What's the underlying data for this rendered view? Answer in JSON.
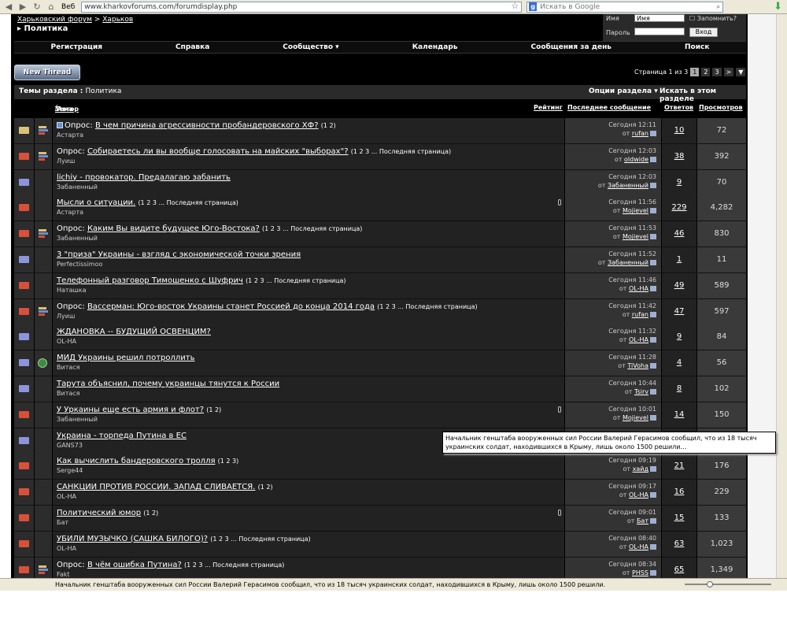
{
  "browser": {
    "web_label": "Веб",
    "url": "www.kharkovforums.com/forumdisplay.php",
    "search_placeholder": "Искать в Google"
  },
  "breadcrumb": {
    "root": "Харьковский форум",
    "parent": "Харьков",
    "current": "Политика"
  },
  "login": {
    "user_label": "Имя",
    "user_value": "Имя",
    "remember": "Запомнить?",
    "pass_label": "Пароль",
    "submit": "Вход"
  },
  "nav": [
    "Регистрация",
    "Справка",
    "Сообщество ▾",
    "Календарь",
    "Сообщения за день",
    "Поиск"
  ],
  "new_thread": "New Thread",
  "pager": {
    "label": "Страница 1 из 3",
    "pages": [
      "1",
      "2",
      "3",
      ">"
    ]
  },
  "table": {
    "title": "Темы раздела",
    "section": "Политика",
    "options": "Опции раздела ▾",
    "search": "Искать в этом разделе",
    "col_topic": "Тема",
    "col_author": "Автор",
    "col_rating": "Рейтинг",
    "col_last": "Последнее сообщение",
    "col_replies": "Ответов",
    "col_views": "Просмотров"
  },
  "threads": [
    {
      "prefix": "Опрос:",
      "title": "В чем причина агрессивности пробандеровского ХФ?",
      "pages": "(1 2)",
      "author": "Астарта",
      "time": "Сегодня 12:11",
      "by": "rufan",
      "replies": "10",
      "views": "72"
    },
    {
      "prefix": "Опрос:",
      "title": "Собираетесь ли вы вообще голосовать на майских \"выборах\"?",
      "pages": "(1 2 3 ... Последняя страница)",
      "author": "Луиш",
      "time": "Сегодня 12:03",
      "by": "oldwide",
      "replies": "38",
      "views": "392"
    },
    {
      "prefix": "",
      "title": "lichiy - провокатор. Предалагаю забанить",
      "pages": "",
      "author": "Забаненный",
      "time": "Сегодня 12:03",
      "by": "Забаненный",
      "replies": "9",
      "views": "70"
    },
    {
      "prefix": "",
      "title": "Мысли о ситуации.",
      "pages": "(1 2 3 ... Последняя страница)",
      "author": "Астарта",
      "time": "Сегодня 11:56",
      "by": "Mojievel",
      "replies": "229",
      "views": "4,282"
    },
    {
      "prefix": "Опрос:",
      "title": "Каким Вы видите будущее Юго-Востока?",
      "pages": "(1 2 3 ... Последняя страница)",
      "author": "Забаненный",
      "time": "Сегодня 11:53",
      "by": "Mojievel",
      "replies": "46",
      "views": "830"
    },
    {
      "prefix": "",
      "title": "3 \"приза\" Украины - взгляд с экономической точки зрения",
      "pages": "",
      "author": "Perfectissimoo",
      "time": "Сегодня 11:52",
      "by": "Забаненный",
      "replies": "1",
      "views": "11"
    },
    {
      "prefix": "",
      "title": "Телефонный разговор Тимошенко с Шуфрич",
      "pages": "(1 2 3 ... Последняя страница)",
      "author": "Наташка",
      "time": "Сегодня 11:46",
      "by": "OL-HA",
      "replies": "49",
      "views": "589"
    },
    {
      "prefix": "Опрос:",
      "title": "Вассерман: Юго-восток Украины станет Россией до конца 2014 года",
      "pages": "(1 2 3 ... Последняя страница)",
      "author": "Луиш",
      "time": "Сегодня 11:42",
      "by": "rufan",
      "replies": "47",
      "views": "597"
    },
    {
      "prefix": "",
      "title": "ЖДАНОВКА -- БУДУЩИЙ ОСВЕНЦИМ?",
      "pages": "",
      "author": "OL-HA",
      "time": "Сегодня 11:32",
      "by": "OL-HA",
      "replies": "9",
      "views": "84"
    },
    {
      "prefix": "",
      "title": "МИД Украины решил потроллить",
      "pages": "",
      "author": "Витася",
      "time": "Сегодня 11:28",
      "by": "TiVoha",
      "replies": "4",
      "views": "56"
    },
    {
      "prefix": "",
      "title": "Тарута объяснил, почему украинцы тянутся к России",
      "pages": "",
      "author": "Витася",
      "time": "Сегодня 10:44",
      "by": "Tsirv",
      "replies": "8",
      "views": "102"
    },
    {
      "prefix": "",
      "title": "У Уркаины еще есть армия и флот?",
      "pages": "(1 2)",
      "author": "Забаненный",
      "time": "Сегодня 10:01",
      "by": "Mojievel",
      "replies": "14",
      "views": "150"
    },
    {
      "prefix": "",
      "title": "Украина - торпеда Путина в ЕС",
      "pages": "",
      "author": "GANS73",
      "time": "",
      "by": "",
      "replies": "",
      "views": ""
    },
    {
      "prefix": "",
      "title": "Как вычислить бандеровского тролля",
      "pages": "(1 2 3)",
      "author": "Serge44",
      "time": "Сегодня 09:19",
      "by": "хайд",
      "replies": "21",
      "views": "176"
    },
    {
      "prefix": "",
      "title": "САНКЦИИ ПРОТИВ РОССИИ. ЗАПАД СЛИВАЕТСЯ.",
      "pages": "(1 2)",
      "author": "OL-HA",
      "time": "Сегодня 09:17",
      "by": "OL-HA",
      "replies": "16",
      "views": "229"
    },
    {
      "prefix": "",
      "title": "Политический юмор",
      "pages": "(1 2)",
      "author": "Бат",
      "time": "Сегодня 09:01",
      "by": "Бат",
      "replies": "15",
      "views": "133"
    },
    {
      "prefix": "",
      "title": "УБИЛИ МУЗЫЧКО (САШКА БИЛОГО)?",
      "pages": "(1 2 3 ... Последняя страница)",
      "author": "OL-HA",
      "time": "Сегодня 08:40",
      "by": "OL-HA",
      "replies": "63",
      "views": "1,023"
    },
    {
      "prefix": "Опрос:",
      "title": "В чём ошибка Путина?",
      "pages": "(1 2 3 ... Последняя страница)",
      "author": "Fakt",
      "time": "Сегодня 08:34",
      "by": "PHSS",
      "replies": "65",
      "views": "1,349"
    }
  ],
  "by_prefix": "от",
  "tooltip": "Начальник генштаба вооруженных сил России Валерий Герасимов сообщил, что из 18 тысяч украинских солдат, находившихся в Крыму, лишь около 1500 решили…",
  "status_text": "Начальник генштаба вооруженных сил России Валерий Герасимов сообщил, что из 18 тысяч украинских солдат, находившихся в Крыму, лишь около 1500 решили…",
  "icons": {
    "env_colors": [
      "#d8503a",
      "#8c95dc",
      "#d9c27a"
    ]
  }
}
